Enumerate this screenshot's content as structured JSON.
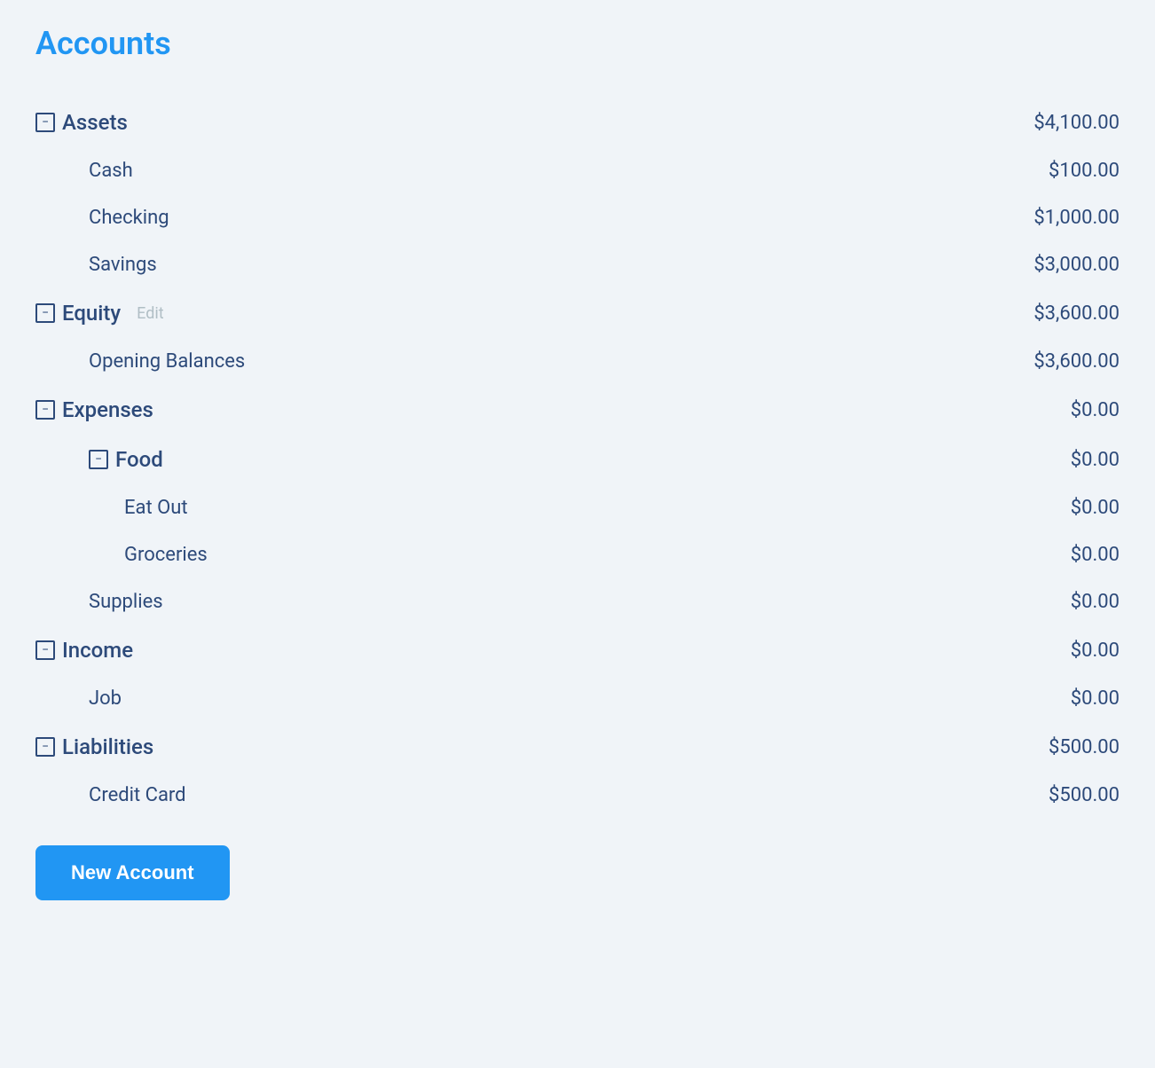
{
  "page": {
    "title": "Accounts"
  },
  "new_account_button": "New Account",
  "accounts": [
    {
      "id": "assets",
      "name": "Assets",
      "amount": "$4,100.00",
      "level": "category",
      "indent": 0,
      "collapsible": true,
      "edit": false
    },
    {
      "id": "cash",
      "name": "Cash",
      "amount": "$100.00",
      "level": "subcategory",
      "indent": 1,
      "collapsible": false,
      "edit": false
    },
    {
      "id": "checking",
      "name": "Checking",
      "amount": "$1,000.00",
      "level": "subcategory",
      "indent": 1,
      "collapsible": false,
      "edit": false
    },
    {
      "id": "savings",
      "name": "Savings",
      "amount": "$3,000.00",
      "level": "subcategory",
      "indent": 1,
      "collapsible": false,
      "edit": false
    },
    {
      "id": "equity",
      "name": "Equity",
      "amount": "$3,600.00",
      "level": "category",
      "indent": 0,
      "collapsible": true,
      "edit": true,
      "edit_label": "Edit"
    },
    {
      "id": "opening-balances",
      "name": "Opening Balances",
      "amount": "$3,600.00",
      "level": "subcategory",
      "indent": 1,
      "collapsible": false,
      "edit": false
    },
    {
      "id": "expenses",
      "name": "Expenses",
      "amount": "$0.00",
      "level": "category",
      "indent": 0,
      "collapsible": true,
      "edit": false
    },
    {
      "id": "food",
      "name": "Food",
      "amount": "$0.00",
      "level": "subcategory-category",
      "indent": 1,
      "collapsible": true,
      "edit": false
    },
    {
      "id": "eat-out",
      "name": "Eat Out",
      "amount": "$0.00",
      "level": "subcategory",
      "indent": 2,
      "collapsible": false,
      "edit": false
    },
    {
      "id": "groceries",
      "name": "Groceries",
      "amount": "$0.00",
      "level": "subcategory",
      "indent": 2,
      "collapsible": false,
      "edit": false
    },
    {
      "id": "supplies",
      "name": "Supplies",
      "amount": "$0.00",
      "level": "subcategory",
      "indent": 1,
      "collapsible": false,
      "edit": false
    },
    {
      "id": "income",
      "name": "Income",
      "amount": "$0.00",
      "level": "category",
      "indent": 0,
      "collapsible": true,
      "edit": false
    },
    {
      "id": "job",
      "name": "Job",
      "amount": "$0.00",
      "level": "subcategory",
      "indent": 1,
      "collapsible": false,
      "edit": false
    },
    {
      "id": "liabilities",
      "name": "Liabilities",
      "amount": "$500.00",
      "level": "category",
      "indent": 0,
      "collapsible": true,
      "edit": false
    },
    {
      "id": "credit-card",
      "name": "Credit Card",
      "amount": "$500.00",
      "level": "subcategory",
      "indent": 1,
      "collapsible": false,
      "edit": false
    }
  ]
}
